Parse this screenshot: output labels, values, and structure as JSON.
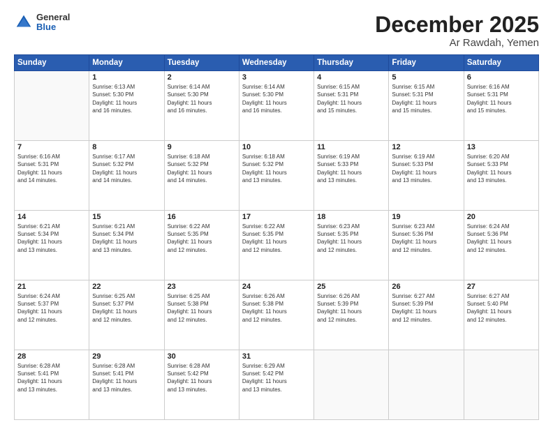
{
  "header": {
    "logo": {
      "general": "General",
      "blue": "Blue"
    },
    "title": "December 2025",
    "subtitle": "Ar Rawdah, Yemen"
  },
  "days_of_week": [
    "Sunday",
    "Monday",
    "Tuesday",
    "Wednesday",
    "Thursday",
    "Friday",
    "Saturday"
  ],
  "weeks": [
    [
      {
        "day": "",
        "info": ""
      },
      {
        "day": "1",
        "info": "Sunrise: 6:13 AM\nSunset: 5:30 PM\nDaylight: 11 hours\nand 16 minutes."
      },
      {
        "day": "2",
        "info": "Sunrise: 6:14 AM\nSunset: 5:30 PM\nDaylight: 11 hours\nand 16 minutes."
      },
      {
        "day": "3",
        "info": "Sunrise: 6:14 AM\nSunset: 5:30 PM\nDaylight: 11 hours\nand 16 minutes."
      },
      {
        "day": "4",
        "info": "Sunrise: 6:15 AM\nSunset: 5:31 PM\nDaylight: 11 hours\nand 15 minutes."
      },
      {
        "day": "5",
        "info": "Sunrise: 6:15 AM\nSunset: 5:31 PM\nDaylight: 11 hours\nand 15 minutes."
      },
      {
        "day": "6",
        "info": "Sunrise: 6:16 AM\nSunset: 5:31 PM\nDaylight: 11 hours\nand 15 minutes."
      }
    ],
    [
      {
        "day": "7",
        "info": "Sunrise: 6:16 AM\nSunset: 5:31 PM\nDaylight: 11 hours\nand 14 minutes."
      },
      {
        "day": "8",
        "info": "Sunrise: 6:17 AM\nSunset: 5:32 PM\nDaylight: 11 hours\nand 14 minutes."
      },
      {
        "day": "9",
        "info": "Sunrise: 6:18 AM\nSunset: 5:32 PM\nDaylight: 11 hours\nand 14 minutes."
      },
      {
        "day": "10",
        "info": "Sunrise: 6:18 AM\nSunset: 5:32 PM\nDaylight: 11 hours\nand 13 minutes."
      },
      {
        "day": "11",
        "info": "Sunrise: 6:19 AM\nSunset: 5:33 PM\nDaylight: 11 hours\nand 13 minutes."
      },
      {
        "day": "12",
        "info": "Sunrise: 6:19 AM\nSunset: 5:33 PM\nDaylight: 11 hours\nand 13 minutes."
      },
      {
        "day": "13",
        "info": "Sunrise: 6:20 AM\nSunset: 5:33 PM\nDaylight: 11 hours\nand 13 minutes."
      }
    ],
    [
      {
        "day": "14",
        "info": "Sunrise: 6:21 AM\nSunset: 5:34 PM\nDaylight: 11 hours\nand 13 minutes."
      },
      {
        "day": "15",
        "info": "Sunrise: 6:21 AM\nSunset: 5:34 PM\nDaylight: 11 hours\nand 13 minutes."
      },
      {
        "day": "16",
        "info": "Sunrise: 6:22 AM\nSunset: 5:35 PM\nDaylight: 11 hours\nand 12 minutes."
      },
      {
        "day": "17",
        "info": "Sunrise: 6:22 AM\nSunset: 5:35 PM\nDaylight: 11 hours\nand 12 minutes."
      },
      {
        "day": "18",
        "info": "Sunrise: 6:23 AM\nSunset: 5:35 PM\nDaylight: 11 hours\nand 12 minutes."
      },
      {
        "day": "19",
        "info": "Sunrise: 6:23 AM\nSunset: 5:36 PM\nDaylight: 11 hours\nand 12 minutes."
      },
      {
        "day": "20",
        "info": "Sunrise: 6:24 AM\nSunset: 5:36 PM\nDaylight: 11 hours\nand 12 minutes."
      }
    ],
    [
      {
        "day": "21",
        "info": "Sunrise: 6:24 AM\nSunset: 5:37 PM\nDaylight: 11 hours\nand 12 minutes."
      },
      {
        "day": "22",
        "info": "Sunrise: 6:25 AM\nSunset: 5:37 PM\nDaylight: 11 hours\nand 12 minutes."
      },
      {
        "day": "23",
        "info": "Sunrise: 6:25 AM\nSunset: 5:38 PM\nDaylight: 11 hours\nand 12 minutes."
      },
      {
        "day": "24",
        "info": "Sunrise: 6:26 AM\nSunset: 5:38 PM\nDaylight: 11 hours\nand 12 minutes."
      },
      {
        "day": "25",
        "info": "Sunrise: 6:26 AM\nSunset: 5:39 PM\nDaylight: 11 hours\nand 12 minutes."
      },
      {
        "day": "26",
        "info": "Sunrise: 6:27 AM\nSunset: 5:39 PM\nDaylight: 11 hours\nand 12 minutes."
      },
      {
        "day": "27",
        "info": "Sunrise: 6:27 AM\nSunset: 5:40 PM\nDaylight: 11 hours\nand 12 minutes."
      }
    ],
    [
      {
        "day": "28",
        "info": "Sunrise: 6:28 AM\nSunset: 5:41 PM\nDaylight: 11 hours\nand 13 minutes."
      },
      {
        "day": "29",
        "info": "Sunrise: 6:28 AM\nSunset: 5:41 PM\nDaylight: 11 hours\nand 13 minutes."
      },
      {
        "day": "30",
        "info": "Sunrise: 6:28 AM\nSunset: 5:42 PM\nDaylight: 11 hours\nand 13 minutes."
      },
      {
        "day": "31",
        "info": "Sunrise: 6:29 AM\nSunset: 5:42 PM\nDaylight: 11 hours\nand 13 minutes."
      },
      {
        "day": "",
        "info": ""
      },
      {
        "day": "",
        "info": ""
      },
      {
        "day": "",
        "info": ""
      }
    ]
  ]
}
